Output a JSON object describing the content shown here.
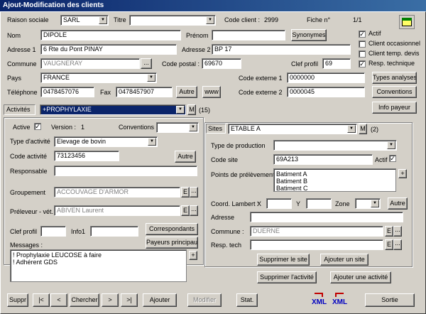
{
  "window": {
    "title": "Ajout-Modification des clients"
  },
  "client": {
    "raison_sociale_label": "Raison sociale",
    "raison_sociale": "SARL",
    "titre_label": "Titre",
    "titre": "",
    "code_client_label": "Code client :",
    "code_client": "2999",
    "fiche_label": "Fiche n°",
    "fiche": "1/1",
    "nom_label": "Nom",
    "nom": "DIPOLE",
    "prenom_label": "Prénom",
    "prenom": "",
    "synonymes_label": "Synonymes",
    "adresse1_label": "Adresse 1",
    "adresse1": "6 Rte du Pont PINAY",
    "adresse2_label": "Adresse 2",
    "adresse2": "BP 17",
    "commune_label": "Commune",
    "commune": "VAUGNERAY",
    "code_postal_label": "Code postal :",
    "code_postal": "69670",
    "clef_profil_label": "Clef profil",
    "clef_profil": "69",
    "pays_label": "Pays",
    "pays": "FRANCE",
    "code_ext1_label": "Code externe 1",
    "code_ext1": "0000000",
    "code_ext2_label": "Code externe 2",
    "code_ext2": "0000045",
    "telephone_label": "Téléphone",
    "telephone": "0478457076",
    "fax_label": "Fax",
    "fax": "0478457907",
    "autre_label": "Autre",
    "www_label": "www",
    "types_analyses_label": "Types analyses",
    "conventions_label": "Conventions",
    "info_payeur_label": "Info payeur",
    "checks": [
      {
        "label": "Actif",
        "checked": true
      },
      {
        "label": "Client occasionnel",
        "checked": false
      },
      {
        "label": "Client temp. devis",
        "checked": false
      },
      {
        "label": "Resp. technique",
        "checked": true
      }
    ]
  },
  "activites": {
    "label": "Activités",
    "value": "+PROPHYLAXIE",
    "m_label": "M",
    "count": "(15)",
    "active_label": "Active",
    "version_label": "Version :",
    "version": "1",
    "conventions_label": "Conventions",
    "conventions": "",
    "type_label": "Type d'activité",
    "type": "Elevage de bovin",
    "code_label": "Code activité",
    "code": "73123456",
    "autre_label": "Autre",
    "responsable_label": "Responsable",
    "responsable": "",
    "groupement_label": "Groupement",
    "groupement": "ACCOUVAGE D'ARMOR",
    "preleveur_label": "Préleveur - vét.",
    "preleveur": "ABIVEN Laurent",
    "e_label": "E",
    "dots": "...",
    "clef_profil_label": "Clef profil",
    "clef_profil": "",
    "info1_label": "Info1",
    "info1": "",
    "correspondants_label": "Correspondants",
    "payeurs_label": "Payeurs principaux",
    "messages_label": "Messages :",
    "messages": [
      "! Prophylaxie LEUCOSE à faire",
      "! Adhérent GDS"
    ],
    "plus": "+",
    "supprimer_label": "Supprimer l'activité",
    "ajouter_label": "Ajouter une activité"
  },
  "sites": {
    "label": "Sites",
    "value": "ETABLE A",
    "m_label": "M",
    "count": "(2)",
    "type_prod_label": "Type de production",
    "type_prod": "",
    "code_label": "Code site",
    "code": "69A213",
    "actif_label": "Actif",
    "points_label": "Points de prélèvement",
    "points": [
      "Batiment A",
      "Batiment B",
      "Batiment C"
    ],
    "lambert_label": "Coord. Lambert :",
    "x_label": "X",
    "y_label": "Y",
    "zone_label": "Zone",
    "autre_label": "Autre",
    "adresse_label": "Adresse",
    "adresse": "",
    "commune_label": "Commune :",
    "commune": "DUERNE",
    "resp_label": "Resp. tech",
    "resp": "",
    "supprimer_label": "Supprimer le site",
    "ajouter_label": "Ajouter un site"
  },
  "toolbar": {
    "suppr": "Suppr",
    "first": "|<",
    "prev": "<",
    "chercher": "Chercher",
    "next": ">",
    "last": ">|",
    "ajouter": "Ajouter",
    "modifier": "Modifier",
    "stat": "Stat.",
    "xml": "XML",
    "sortie": "Sortie"
  }
}
